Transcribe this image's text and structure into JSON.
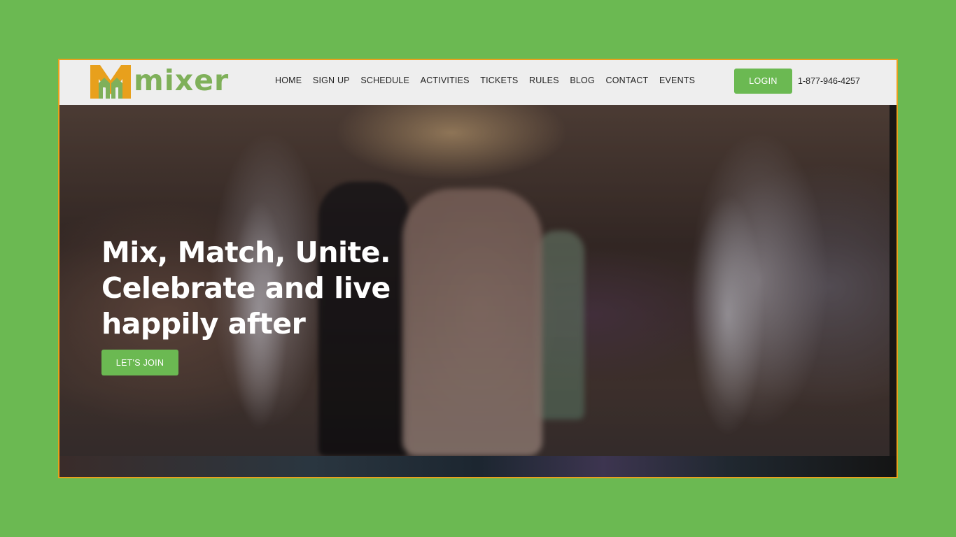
{
  "brand": {
    "name": "mixer",
    "colors": {
      "page_background": "#6bb952",
      "frame_border": "#e8a01c",
      "accent_green": "#6bb952",
      "logo_orange": "#e8a01c",
      "logo_green": "#7fb05a"
    }
  },
  "nav": {
    "items": [
      "HOME",
      "SIGN UP",
      "SCHEDULE",
      "ACTIVITIES",
      "TICKETS",
      "RULES",
      "BLOG",
      "CONTACT",
      "EVENTS"
    ]
  },
  "header": {
    "login_label": "LOGIN",
    "phone": "1-877-946-4257"
  },
  "hero": {
    "title_lines": [
      "Mix, Match, Unite.",
      "Celebrate and live",
      "happily after"
    ],
    "cta_label": "LET'S JOIN"
  }
}
